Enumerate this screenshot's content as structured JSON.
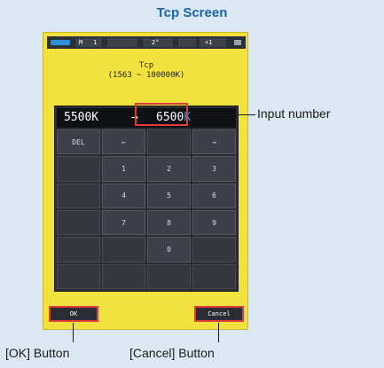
{
  "caption": "Tcp Screen",
  "statusbar": {
    "items": [
      "M",
      "1",
      "2°",
      "+1"
    ]
  },
  "screen": {
    "title": "Tcp",
    "range": "(1563 ~ 100000K)"
  },
  "display": {
    "current_value": "5500K",
    "arrow": "→",
    "input_value": "6500",
    "input_unit": "K"
  },
  "keypad": {
    "keys": [
      "DEL",
      "←",
      "",
      "→",
      "",
      "1",
      "2",
      "3",
      "",
      "4",
      "5",
      "6",
      "",
      "7",
      "8",
      "9",
      "",
      "",
      "0",
      "",
      "",
      "",
      "",
      ""
    ]
  },
  "softkeys": {
    "ok": "OK",
    "cancel": "Cancel"
  },
  "callouts": {
    "input_number": "Input number",
    "ok_button": "[OK] Button",
    "cancel_button": "[Cancel] Button"
  },
  "colors": {
    "accent": "#e23b3b",
    "device": "#f2e23e",
    "caption": "#1a64a8",
    "unit": "#2f9ee8"
  }
}
